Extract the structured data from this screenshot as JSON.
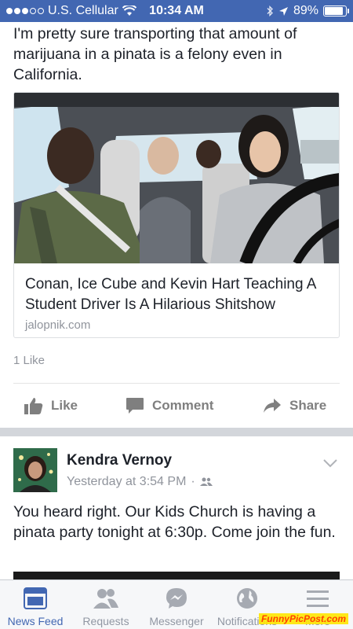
{
  "status_bar": {
    "carrier": "U.S. Cellular",
    "time": "10:34 AM",
    "battery_percent": "89%",
    "battery_level": 0.89,
    "signal_dots_filled": 3,
    "signal_dots_total": 5,
    "wifi_icon": "wifi-icon",
    "location_icon": "location-arrow-icon",
    "bluetooth_icon": "bluetooth-icon"
  },
  "post1": {
    "text": "I'm pretty sure transporting that amount of marijuana in a pinata is a felony even in California.",
    "link": {
      "title": "Conan, Ice Cube and Kevin Hart Teaching A Student Driver Is A Hilarious Shitshow",
      "domain": "jalopnik.com"
    },
    "likes_text": "1 Like",
    "actions": {
      "like": "Like",
      "comment": "Comment",
      "share": "Share"
    }
  },
  "post2": {
    "author": "Kendra Vernoy",
    "timestamp": "Yesterday at 3:54 PM",
    "separator": "·",
    "audience_icon": "friends-icon",
    "text": "You heard right. Our Kids Church is having a pinata party tonight at 6:30p. Come join the fun."
  },
  "tab_bar": {
    "tabs": [
      {
        "label": "News Feed",
        "icon": "news-feed-icon",
        "active": true
      },
      {
        "label": "Requests",
        "icon": "friend-requests-icon",
        "active": false
      },
      {
        "label": "Messenger",
        "icon": "messenger-icon",
        "active": false
      },
      {
        "label": "Notifications",
        "icon": "globe-icon",
        "active": false
      },
      {
        "label": "More",
        "icon": "menu-icon",
        "active": false
      }
    ]
  },
  "watermark": "FunnyPicPost.com",
  "colors": {
    "brand_blue": "#4267b2",
    "text": "#1d2129",
    "muted": "#90949c",
    "action_gray": "#7f7f7f"
  }
}
